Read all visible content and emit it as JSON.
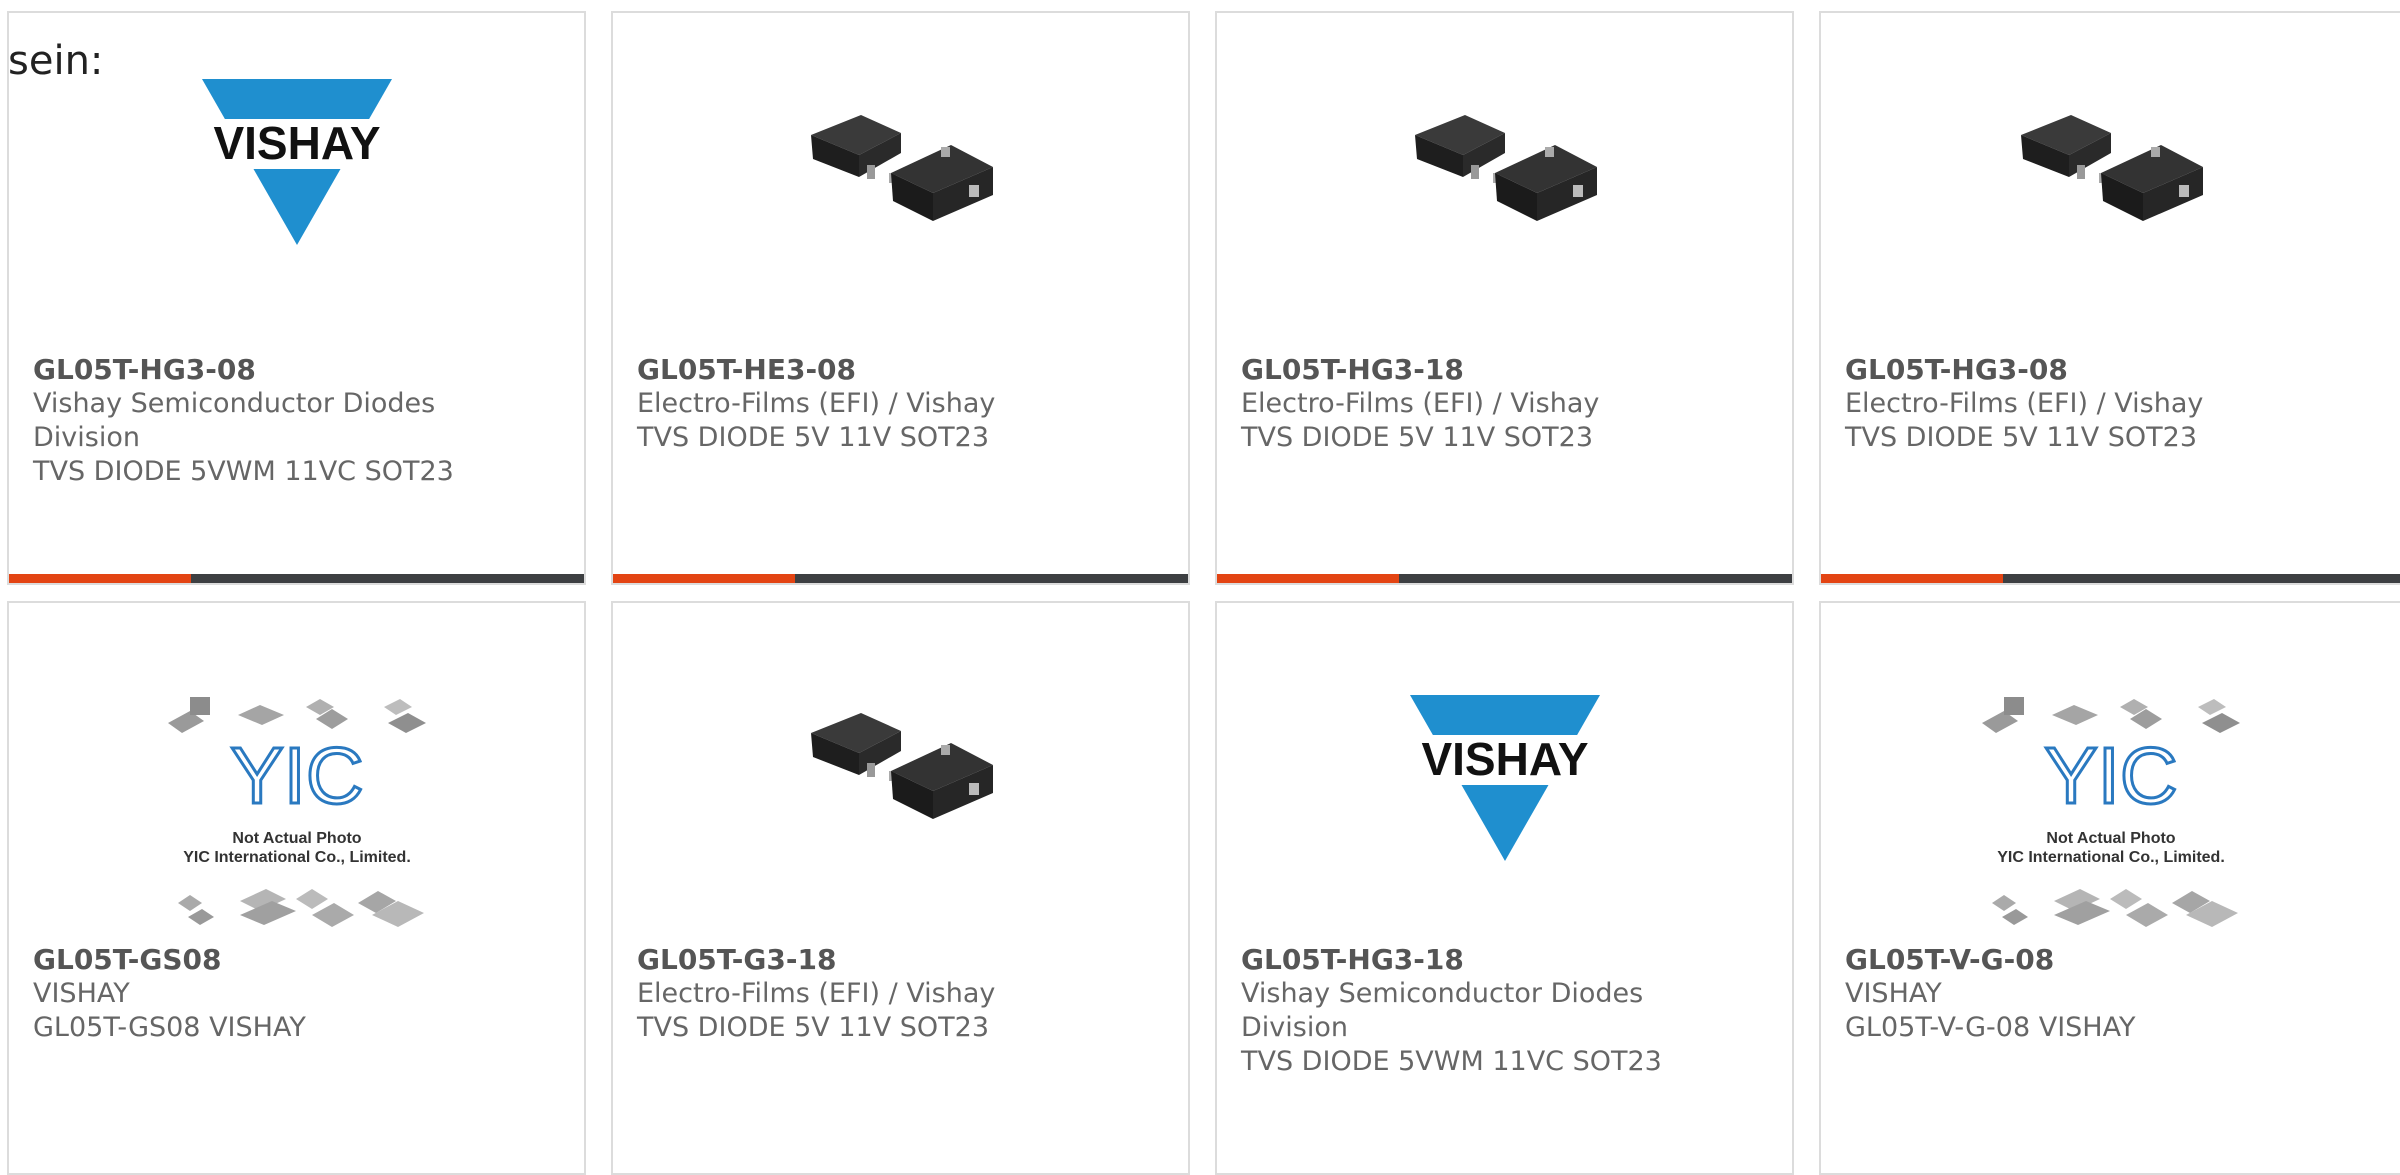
{
  "fragment_text": "sein:",
  "colors": {
    "accent": "#e34413",
    "bar": "#3d3f42",
    "border": "#dcdcdc",
    "vishay_blue": "#1f8fcf",
    "yic_blue": "#2a79c0"
  },
  "products": [
    {
      "part": "GL05T-HG3-08",
      "line1": "Vishay Semiconductor Diodes",
      "line2": "Division",
      "line3": "TVS DIODE 5VWM 11VC SOT23",
      "image": "vishay-logo",
      "progress": 0.3
    },
    {
      "part": "GL05T-HE3-08",
      "line1": "Electro-Films (EFI) / Vishay",
      "line2": "TVS DIODE 5V 11V SOT23",
      "line3": "",
      "image": "sot23-package",
      "progress": 0.3
    },
    {
      "part": "GL05T-HG3-18",
      "line1": "Electro-Films (EFI) / Vishay",
      "line2": "TVS DIODE 5V 11V SOT23",
      "line3": "",
      "image": "sot23-package",
      "progress": 0.3
    },
    {
      "part": "GL05T-HG3-08",
      "line1": "Electro-Films (EFI) / Vishay",
      "line2": "TVS DIODE 5V 11V SOT23",
      "line3": "",
      "image": "sot23-package",
      "progress": 0.3
    },
    {
      "part": "GL05T-GS08",
      "line1": "VISHAY",
      "line2": "GL05T-GS08 VISHAY",
      "line3": "",
      "image": "yic-placeholder"
    },
    {
      "part": "GL05T-G3-18",
      "line1": "Electro-Films (EFI) / Vishay",
      "line2": "TVS DIODE 5V 11V SOT23",
      "line3": "",
      "image": "sot23-package"
    },
    {
      "part": "GL05T-HG3-18",
      "line1": "Vishay Semiconductor Diodes",
      "line2": "Division",
      "line3": "TVS DIODE 5VWM 11VC SOT23",
      "image": "vishay-logo"
    },
    {
      "part": "GL05T-V-G-08",
      "line1": "VISHAY",
      "line2": "GL05T-V-G-08 VISHAY",
      "line3": "",
      "image": "yic-placeholder"
    }
  ],
  "logo_text": {
    "vishay": "VISHAY",
    "yic_line1": "Not Actual Photo",
    "yic_line2": "YIC International Co., Limited."
  }
}
